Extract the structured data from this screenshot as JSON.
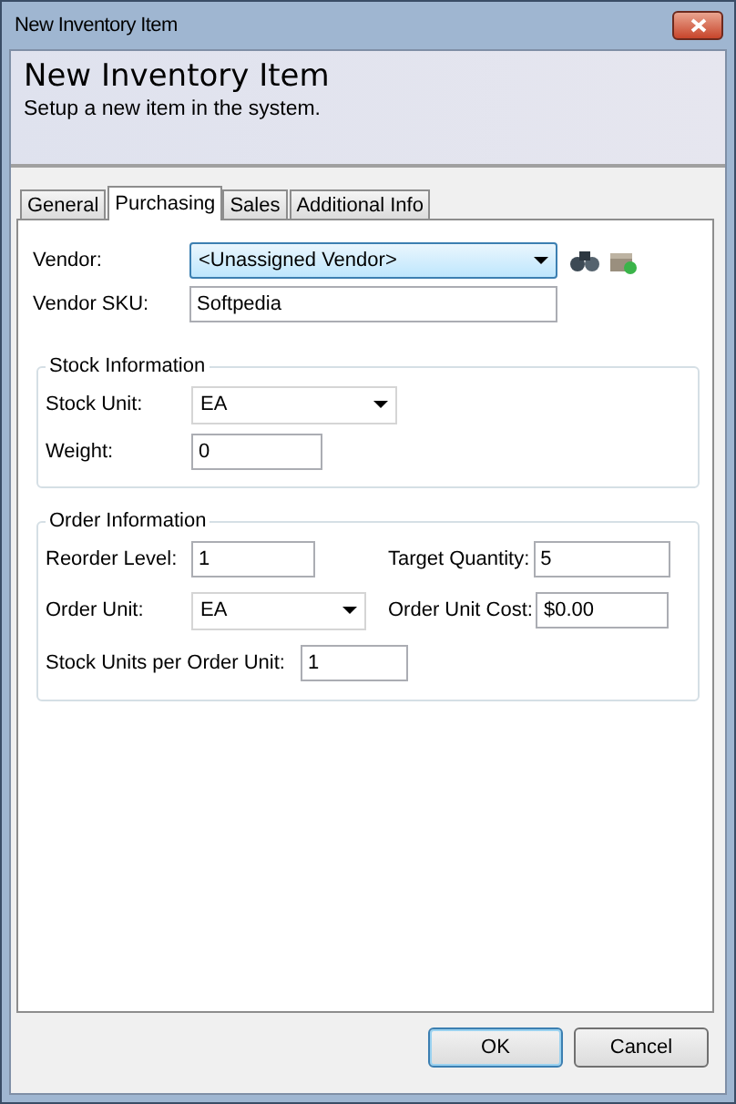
{
  "window": {
    "title": "New Inventory Item"
  },
  "header": {
    "title": "New Inventory Item",
    "subtitle": "Setup a new item in the system."
  },
  "tabs": [
    {
      "label": "General",
      "selected": false
    },
    {
      "label": "Purchasing",
      "selected": true
    },
    {
      "label": "Sales",
      "selected": false
    },
    {
      "label": "Additional Info",
      "selected": false
    }
  ],
  "vendor": {
    "label": "Vendor:",
    "value": "<Unassigned Vendor>",
    "focused": true
  },
  "vendor_sku": {
    "label": "Vendor SKU:",
    "value": "Softpedia"
  },
  "stock_information": {
    "title": "Stock Information",
    "fields": [
      {
        "label": "Stock Unit:",
        "value": "EA",
        "kind": "dropdown"
      },
      {
        "label": "Weight:",
        "value": "0",
        "kind": "text"
      }
    ]
  },
  "order_information": {
    "title": "Order Information",
    "reorder_level": {
      "label": "Reorder Level:",
      "value": "1"
    },
    "target_quantity": {
      "label": "Target Quantity:",
      "value": "5"
    },
    "order_unit": {
      "label": "Order Unit:",
      "value": "EA"
    },
    "order_unit_cost": {
      "label": "Order Unit Cost:",
      "value": "$0.00"
    },
    "stock_units_per_order_unit": {
      "label": "Stock Units per Order Unit:",
      "value": "1"
    }
  },
  "buttons": [
    {
      "label": "OK",
      "selected": true
    },
    {
      "label": "Cancel",
      "selected": false
    }
  ]
}
